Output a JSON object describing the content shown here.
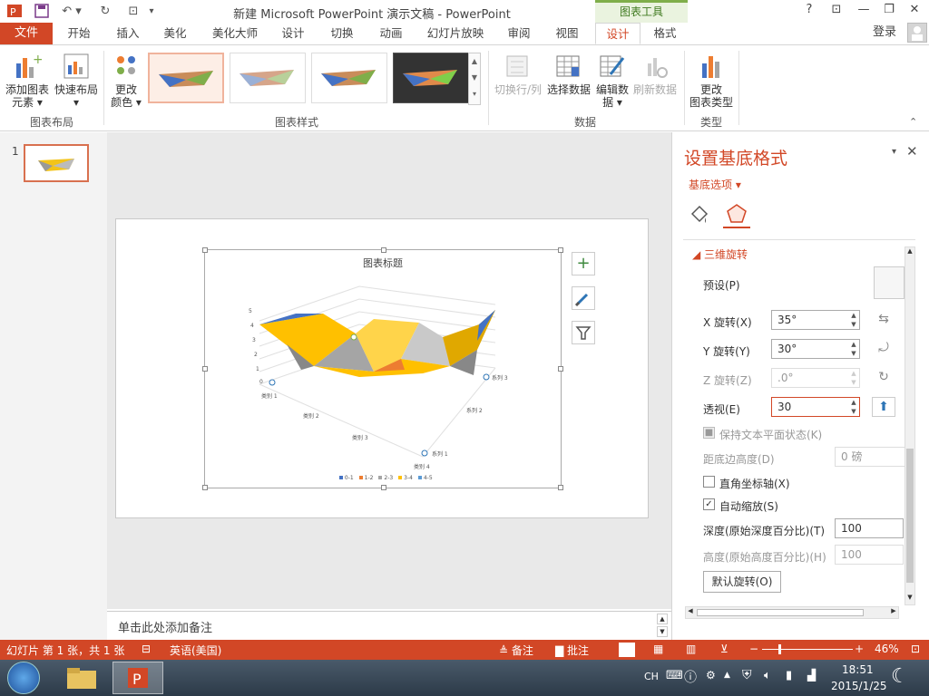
{
  "titlebar": {
    "app_title": "新建 Microsoft PowerPoint 演示文稿 - PowerPoint",
    "context_tab": "图表工具",
    "help": "?",
    "restore_ribbon": "⊡",
    "minimize": "—",
    "maximize": "❐",
    "close": "✕"
  },
  "tabs": {
    "file": "文件",
    "items": [
      "开始",
      "插入",
      "美化",
      "美化大师",
      "设计",
      "切换",
      "动画",
      "幻灯片放映",
      "审阅",
      "视图",
      "设计",
      "格式"
    ],
    "login": "登录"
  },
  "ribbon": {
    "add_element_l1": "添加图表",
    "add_element_l2": "元素",
    "quick_layout": "快速布局",
    "group_layout": "图表布局",
    "change_color_l1": "更改",
    "change_color_l2": "颜色",
    "group_styles": "图表样式",
    "switch_row_col": "切换行/列",
    "select_data": "选择数据",
    "edit_data_l1": "编辑数",
    "edit_data_l2": "据",
    "refresh_data": "刷新数据",
    "group_data": "数据",
    "change_type_l1": "更改",
    "change_type_l2": "图表类型",
    "group_type": "类型"
  },
  "slides_panel": {
    "slide_number": "1"
  },
  "chart": {
    "title": "图表标题",
    "y_ticks": [
      "0",
      "1",
      "2",
      "3",
      "4",
      "5"
    ],
    "categories": [
      "类别 1",
      "类别 2",
      "类别 3",
      "类别 4"
    ],
    "series_labels": [
      "系列 1",
      "系列 2",
      "系列 3"
    ],
    "legend": [
      {
        "label": "0-1",
        "color": "#4472c4"
      },
      {
        "label": "1-2",
        "color": "#ed7d31"
      },
      {
        "label": "2-3",
        "color": "#a5a5a5"
      },
      {
        "label": "3-4",
        "color": "#ffc000"
      },
      {
        "label": "4-5",
        "color": "#5b9bd5"
      }
    ]
  },
  "notes": {
    "placeholder": "单击此处添加备注"
  },
  "pane": {
    "title": "设置基底格式",
    "options_label": "基底选项",
    "section_title": "三维旋转",
    "preset_label": "预设(P)",
    "x_rotation_label": "X 旋转(X)",
    "x_rotation_value": "35°",
    "y_rotation_label": "Y 旋转(Y)",
    "y_rotation_value": "30°",
    "z_rotation_label": "Z 旋转(Z)",
    "z_rotation_value": ".0°",
    "perspective_label": "透视(E)",
    "perspective_value": "30",
    "keep_text_flat_label": "保持文本平面状态(K)",
    "distance_label": "距底边高度(D)",
    "distance_value": "0 磅",
    "right_angle_label": "直角坐标轴(X)",
    "autoscale_label": "自动缩放(S)",
    "depth_label": "深度(原始深度百分比)(T)",
    "depth_value": "100",
    "height_label": "高度(原始高度百分比)(H)",
    "height_value": "100",
    "reset_button": "默认旋转(O)"
  },
  "status": {
    "slide_info": "幻灯片 第 1 张，共 1 张",
    "language": "英语(美国)",
    "notes": "备注",
    "comments": "批注",
    "zoom": "46%"
  },
  "taskbar": {
    "ime": "CH",
    "time": "18:51",
    "date": "2015/1/25"
  },
  "colors": {
    "accent": "#d24726",
    "chart_tools": "#7fae4a"
  }
}
